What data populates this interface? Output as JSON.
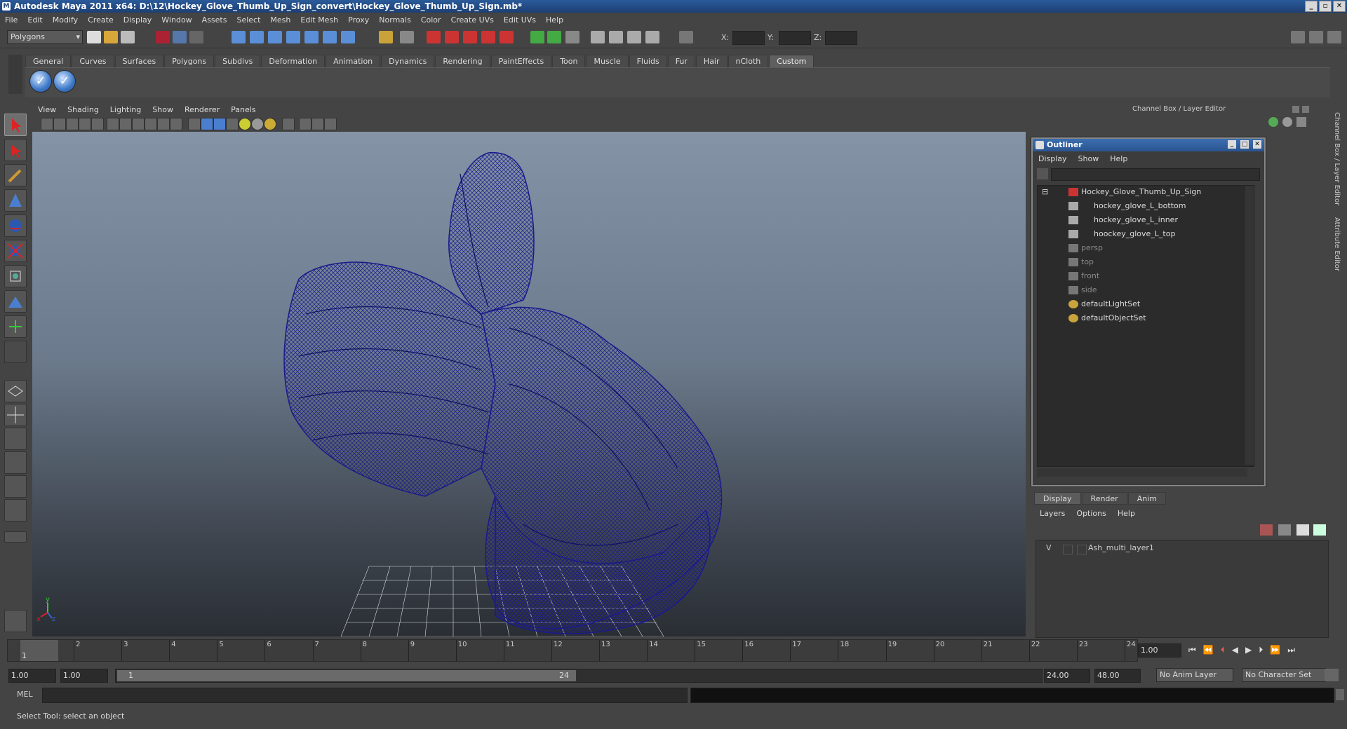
{
  "window": {
    "title": "Autodesk Maya 2011 x64: D:\\12\\Hockey_Glove_Thumb_Up_Sign_convert\\Hockey_Glove_Thumb_Up_Sign.mb*"
  },
  "menubar": [
    "File",
    "Edit",
    "Modify",
    "Create",
    "Display",
    "Window",
    "Assets",
    "Select",
    "Mesh",
    "Edit Mesh",
    "Proxy",
    "Normals",
    "Color",
    "Create UVs",
    "Edit UVs",
    "Help"
  ],
  "statusline": {
    "menuset": "Polygons",
    "x_label": "X:",
    "y_label": "Y:",
    "z_label": "Z:"
  },
  "shelf": {
    "tabs": [
      "General",
      "Curves",
      "Surfaces",
      "Polygons",
      "Subdivs",
      "Deformation",
      "Animation",
      "Dynamics",
      "Rendering",
      "PaintEffects",
      "Toon",
      "Muscle",
      "Fluids",
      "Fur",
      "Hair",
      "nCloth",
      "Custom"
    ],
    "active_tab": "Custom"
  },
  "viewport": {
    "menu": [
      "View",
      "Shading",
      "Lighting",
      "Show",
      "Renderer",
      "Panels"
    ],
    "axis_y": "y",
    "axis_x": "x",
    "axis_z": "z",
    "wire_color": "#1a1a8c"
  },
  "channelbox": {
    "title": "Channel Box / Layer Editor"
  },
  "outliner": {
    "title": "Outliner",
    "menu": [
      "Display",
      "Show",
      "Help"
    ],
    "items": [
      {
        "label": "Hockey_Glove_Thumb_Up_Sign",
        "dim": false
      },
      {
        "label": "hockey_glove_L_bottom",
        "dim": false
      },
      {
        "label": "hockey_glove_L_inner",
        "dim": false
      },
      {
        "label": "hoockey_glove_L_top",
        "dim": false
      },
      {
        "label": "persp",
        "dim": true
      },
      {
        "label": "top",
        "dim": true
      },
      {
        "label": "front",
        "dim": true
      },
      {
        "label": "side",
        "dim": true
      },
      {
        "label": "defaultLightSet",
        "dim": false
      },
      {
        "label": "defaultObjectSet",
        "dim": false
      }
    ]
  },
  "layer_editor": {
    "tabs": [
      "Display",
      "Render",
      "Anim"
    ],
    "active_tab": "Display",
    "menu": [
      "Layers",
      "Options",
      "Help"
    ],
    "layer": {
      "visible": "V",
      "name": "Ash_multi_layer1"
    }
  },
  "side_tabs": {
    "channel": "Channel Box / Layer Editor",
    "attribute": "Attribute Editor"
  },
  "timeline": {
    "ticks": [
      "1",
      "2",
      "3",
      "4",
      "5",
      "6",
      "7",
      "8",
      "9",
      "10",
      "11",
      "12",
      "13",
      "14",
      "15",
      "16",
      "17",
      "18",
      "19",
      "20",
      "21",
      "22",
      "23",
      "24"
    ],
    "current_frame": "1",
    "current_field": "1.00"
  },
  "range": {
    "start": "1.00",
    "start2": "1.00",
    "slider_start": "1",
    "slider_end": "24",
    "end": "24.00",
    "end2": "48.00",
    "anim_layer": "No Anim Layer",
    "char_set": "No Character Set"
  },
  "command": {
    "label": "MEL"
  },
  "helpline": {
    "text": "Select Tool: select an object"
  }
}
